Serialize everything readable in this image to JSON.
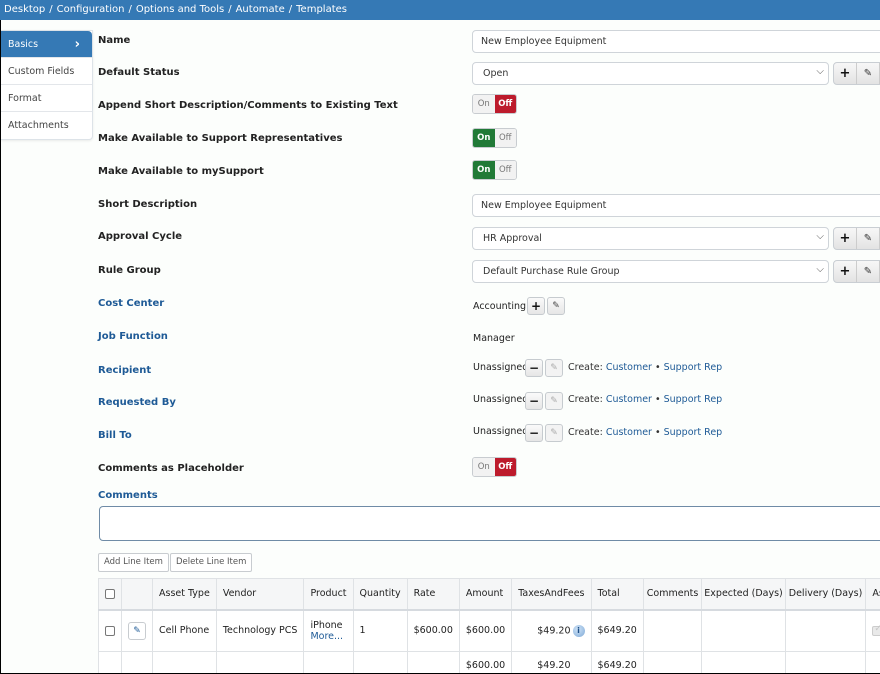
{
  "breadcrumb": [
    "Desktop",
    "Configuration",
    "Options and Tools",
    "Automate",
    "Templates"
  ],
  "sidebar": {
    "items": [
      {
        "label": "Basics",
        "active": true
      },
      {
        "label": "Custom Fields",
        "active": false
      },
      {
        "label": "Format",
        "active": false
      },
      {
        "label": "Attachments",
        "active": false
      }
    ]
  },
  "form": {
    "name": {
      "label": "Name",
      "value": "New Employee Equipment"
    },
    "default_status": {
      "label": "Default Status",
      "value": "Open"
    },
    "append_short_desc": {
      "label": "Append Short Description/Comments to Existing Text",
      "on": "On",
      "off": "Off",
      "state": "off"
    },
    "available_support_reps": {
      "label": "Make Available to Support Representatives",
      "on": "On",
      "off": "Off",
      "state": "on"
    },
    "available_mysupport": {
      "label": "Make Available to mySupport",
      "on": "On",
      "off": "Off",
      "state": "on"
    },
    "short_description": {
      "label": "Short Description",
      "value": "New Employee Equipment"
    },
    "approval_cycle": {
      "label": "Approval Cycle",
      "value": "HR Approval"
    },
    "rule_group": {
      "label": "Rule Group",
      "value": "Default Purchase Rule Group"
    },
    "cost_center": {
      "label": "Cost Center",
      "value": "Accounting"
    },
    "job_function": {
      "label": "Job Function",
      "value": "Manager"
    },
    "recipient": {
      "label": "Recipient",
      "value": "Unassigned",
      "create_label": "Create:",
      "link1": "Customer",
      "link2": "Support Rep"
    },
    "requested_by": {
      "label": "Requested By",
      "value": "Unassigned",
      "create_label": "Create:",
      "link1": "Customer",
      "link2": "Support Rep"
    },
    "bill_to": {
      "label": "Bill To",
      "value": "Unassigned",
      "create_label": "Create:",
      "link1": "Customer",
      "link2": "Support Rep"
    },
    "comments_placeholder": {
      "label": "Comments as Placeholder",
      "on": "On",
      "off": "Off",
      "state": "off"
    },
    "comments": {
      "label": "Comments",
      "value": ""
    }
  },
  "line_items": {
    "add_label": "Add Line Item",
    "delete_label": "Delete Line Item",
    "columns": [
      "",
      "",
      "Asset Type",
      "Vendor",
      "Product",
      "Quantity",
      "Rate",
      "Amount",
      "TaxesAndFees",
      "Total",
      "Comments",
      "Expected (Days)",
      "Delivery (Days)",
      "Asset Create"
    ],
    "rows": [
      {
        "asset_type": "Cell Phone",
        "vendor": "Technology PCS",
        "product": "iPhone",
        "product_more": "More...",
        "quantity": "1",
        "rate": "$600.00",
        "amount": "$600.00",
        "taxes": "$49.20",
        "total": "$649.20",
        "comments": "",
        "expected": "",
        "delivery": "",
        "asset_create_checked": true
      }
    ],
    "totals": {
      "amount": "$600.00",
      "taxes": "$49.20",
      "total": "$649.20"
    }
  },
  "colors": {
    "header_blue": "#3579b5",
    "toggle_on": "#217a37",
    "toggle_off": "#bd1b2c",
    "link_blue": "#1e5a96"
  }
}
